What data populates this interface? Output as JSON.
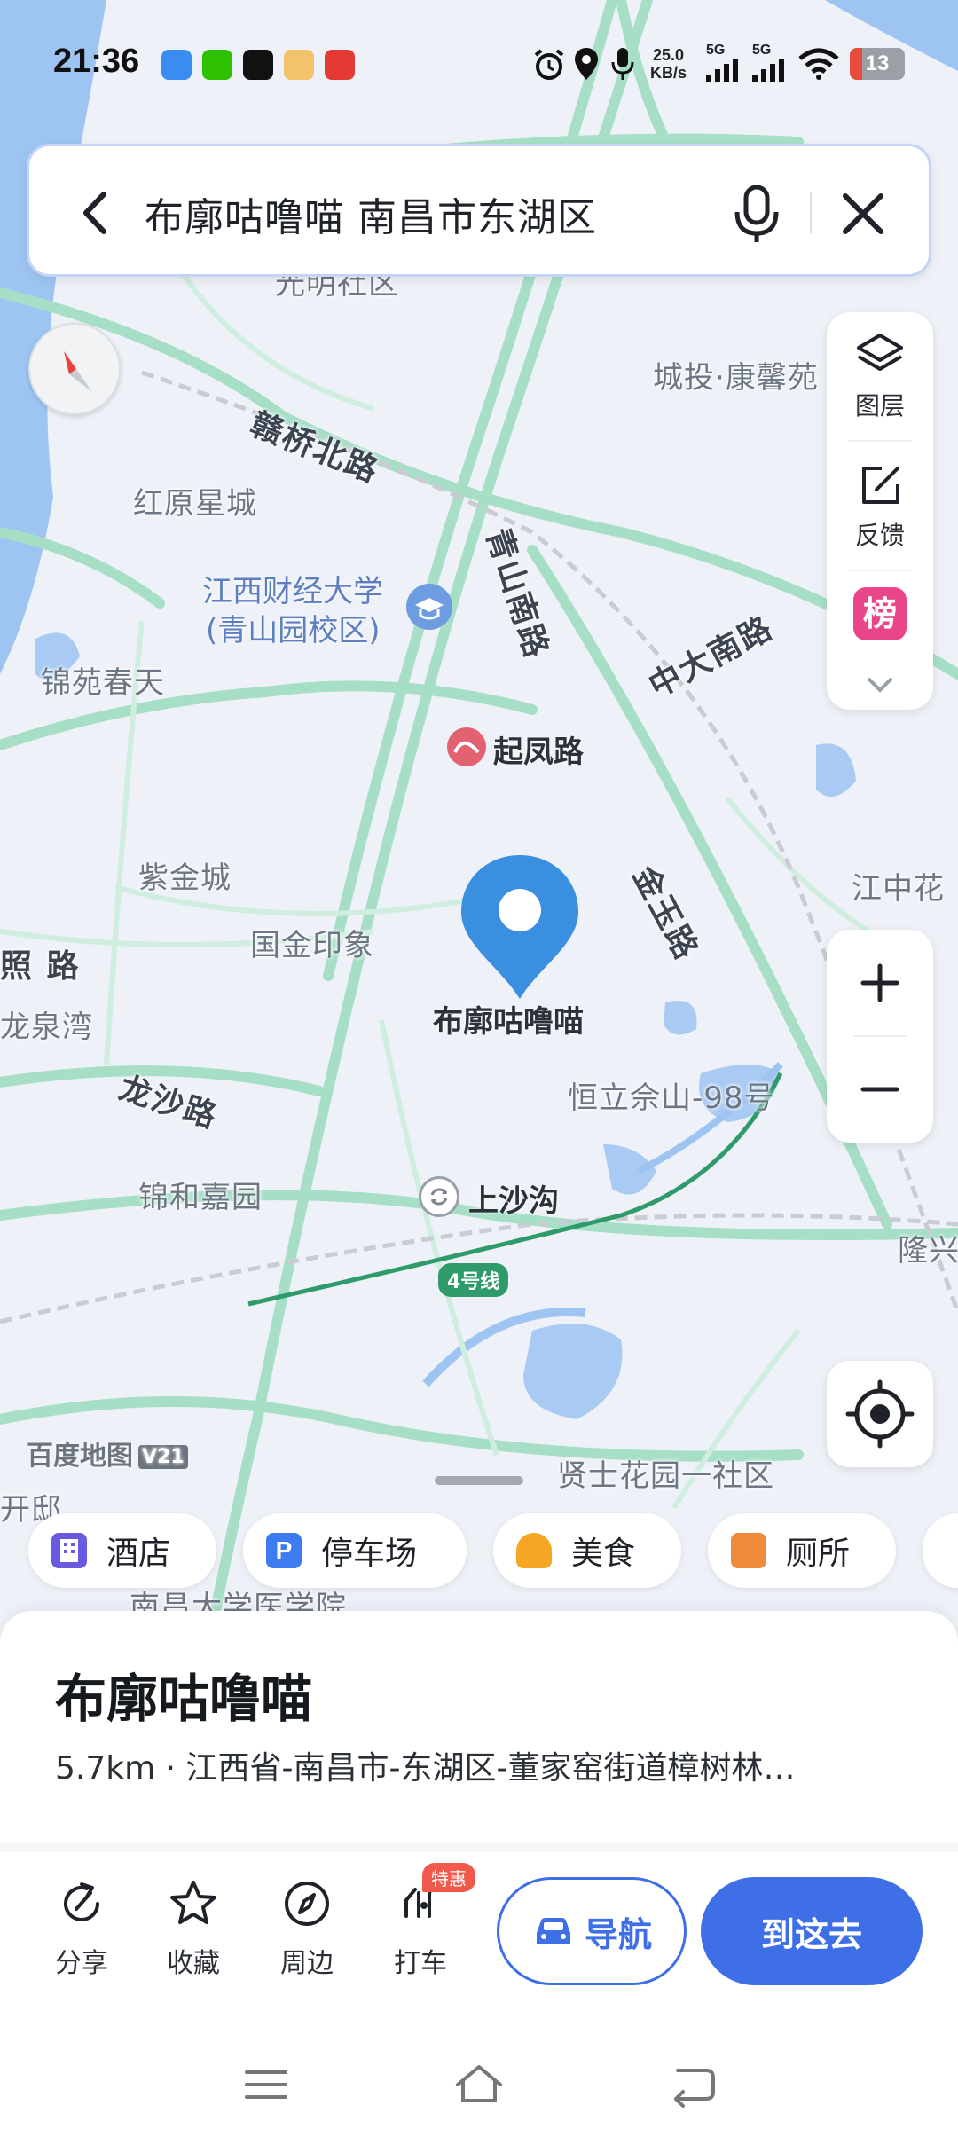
{
  "status_bar": {
    "time": "21:36",
    "net_speed_value": "25.0",
    "net_speed_unit": "KB/s",
    "signal_1": "5G",
    "signal_2": "5G",
    "battery": "13",
    "app_icons": [
      "message-app-icon",
      "wechat-icon",
      "douyin-icon",
      "game-app-icon",
      "red-app-icon"
    ],
    "status_icons": [
      "alarm-icon",
      "location-icon",
      "mic-icon",
      "wifi-icon"
    ]
  },
  "search": {
    "query": "布廓咕噜喵 南昌市东湖区"
  },
  "toolbar": {
    "layers_label": "图层",
    "feedback_label": "反馈",
    "rank_badge": "榜"
  },
  "map": {
    "labels": {
      "top_area": "光明社区",
      "chengtou": "城投·康馨苑",
      "hongyuan": "红原星城",
      "jufe": "江西财经大学",
      "jufe_campus": "(青山园校区)",
      "jinyuan": "锦苑春天",
      "zijin": "紫金城",
      "guojin": "国金印象",
      "longquan": "龙泉湾",
      "jinhe": "锦和嘉园",
      "hengli": "恒立佘山-98号",
      "jiangzhong": "江中花",
      "longxing": "隆兴",
      "xianshi": "贤士花园一社区",
      "nanda": "南昌大学医学院",
      "left_edge": "开邸"
    },
    "roads": {
      "ganqiao": "赣桥北路",
      "qingshan": "青山南路",
      "zhongda": "中大南路",
      "jinyu": "金玉路",
      "longsha": "龙沙路",
      "zhao": "照 路"
    },
    "metro": {
      "qifeng": "起凤路",
      "shangshagou": "上沙沟",
      "line4": "4号线"
    },
    "pin_label": "布廓咕噜喵",
    "brand": "百度地图",
    "brand_version": "V21"
  },
  "chips": [
    {
      "label": "酒店",
      "icon": "hotel-icon",
      "color": "#6a5ae0"
    },
    {
      "label": "停车场",
      "icon": "parking-icon",
      "color": "#3d7cf0"
    },
    {
      "label": "美食",
      "icon": "food-icon",
      "color": "#f5a623"
    },
    {
      "label": "厕所",
      "icon": "toilet-icon",
      "color": "#f08a3c"
    }
  ],
  "place": {
    "name": "布廓咕噜喵",
    "address": "5.7km · 江西省-南昌市-东湖区-董家窑街道樟树林…"
  },
  "actions": {
    "share": "分享",
    "favorite": "收藏",
    "nearby": "周边",
    "taxi": "打车",
    "taxi_badge": "特惠",
    "navigate": "导航",
    "go_here": "到这去"
  },
  "colors": {
    "accent": "#3f6fe6",
    "pin": "#3b8fe0",
    "metro": "#e36272",
    "road": "#a9e0c8"
  }
}
